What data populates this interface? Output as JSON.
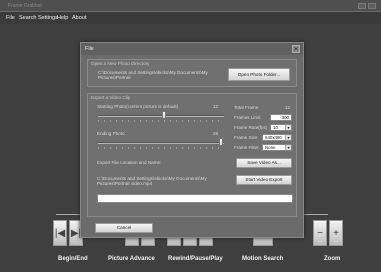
{
  "window": {
    "title": "Frame Grabber"
  },
  "menu": [
    "File",
    "Search Settings",
    "Help",
    "About"
  ],
  "dialog": {
    "title": "File",
    "open_section": {
      "legend": "Open a New Photo Directory",
      "path": "C:\\Documents and Settings\\ebicko\\My Documents\\My Pictures\\Portrait",
      "button": "Open Photo Folder..."
    },
    "export_section": {
      "legend": "Export a Video Clip",
      "starting_label": "Starting Photo(current picture is default)",
      "starting_value": "12",
      "ending_label": "Ending Photo",
      "ending_value": "26",
      "total_frames_label": "Total Frame",
      "total_frames_value": "12",
      "frames_limit_label": "Frames Limit",
      "frames_limit_value": "300",
      "frame_rate_label": "Frame Rate(fps)",
      "frame_rate_value": "10",
      "frame_size_label": "Frame Size",
      "frame_size_value": "640x480",
      "frame_filter_label": "Frame Filter",
      "frame_filter_value": "None",
      "export_location_label": "Export File Location and Name:",
      "save_button": "Save Video As...",
      "export_path": "C:\\Documents and Settings\\ebicko\\My Documents\\My Pictures\\Portrait video.mp4",
      "start_button": "Start Video Export",
      "text_field_value": ""
    },
    "cancel_button": "Cancel"
  },
  "toolbar": {
    "groups": [
      {
        "label": "Begin/End"
      },
      {
        "label": "Picture Advance"
      },
      {
        "label": "Rewind/Pause/Play"
      },
      {
        "label": "Motion Search"
      },
      {
        "label": "Zoom"
      }
    ]
  }
}
